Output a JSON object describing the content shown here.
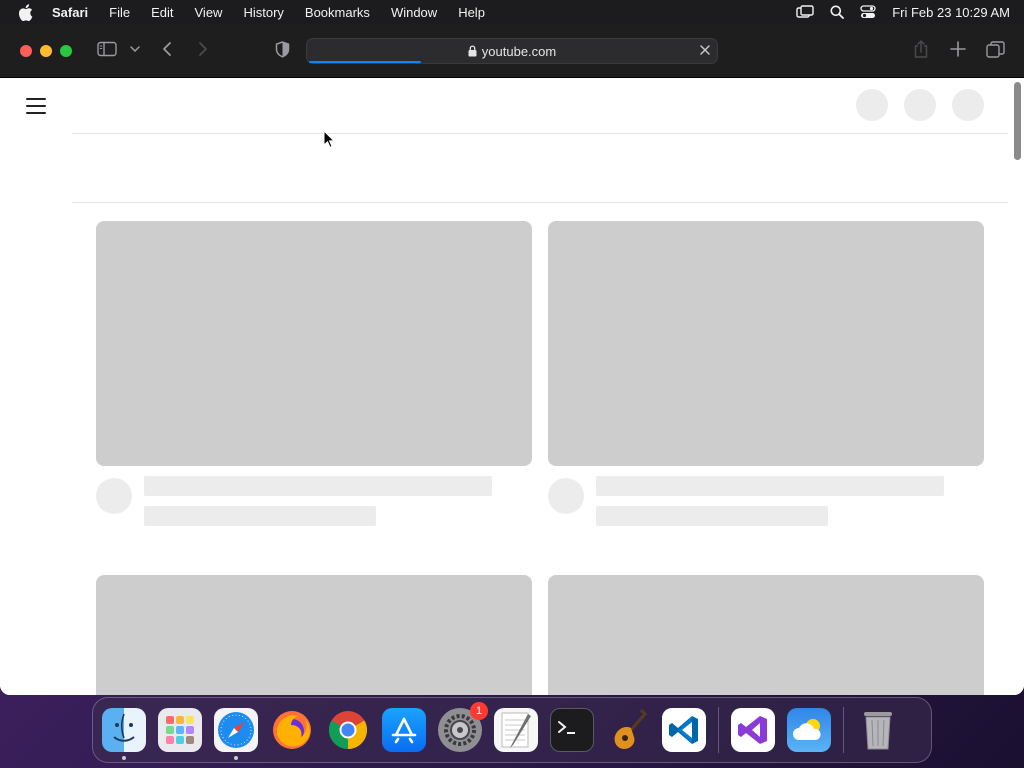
{
  "menubar": {
    "app_name": "Safari",
    "items": [
      "File",
      "Edit",
      "View",
      "History",
      "Bookmarks",
      "Window",
      "Help"
    ],
    "clock": "Fri Feb 23  10:29 AM",
    "status_icons": [
      "screen-mirroring-icon",
      "spotlight-search-icon",
      "control-center-icon"
    ]
  },
  "browser": {
    "url": "youtube.com",
    "loading": true,
    "colors": {
      "progress": "#0a84ff",
      "toolbar": "#1e1e1e"
    }
  },
  "page": {
    "state": "loading-skeleton"
  },
  "dock": {
    "apps": [
      {
        "name": "Finder",
        "icon": "finder-icon",
        "running": true
      },
      {
        "name": "Launchpad",
        "icon": "launchpad-icon",
        "running": false
      },
      {
        "name": "Safari",
        "icon": "safari-icon",
        "running": true
      },
      {
        "name": "Firefox",
        "icon": "firefox-icon",
        "running": false
      },
      {
        "name": "Google Chrome",
        "icon": "chrome-icon",
        "running": false
      },
      {
        "name": "App Store",
        "icon": "app-store-icon",
        "running": false
      },
      {
        "name": "System Settings",
        "icon": "system-settings-icon",
        "running": false,
        "badge": "1"
      },
      {
        "name": "TextEdit",
        "icon": "textedit-icon",
        "running": false
      },
      {
        "name": "Terminal",
        "icon": "terminal-icon",
        "running": false
      },
      {
        "name": "GarageBand",
        "icon": "garageband-icon",
        "running": false
      },
      {
        "name": "Visual Studio Code",
        "icon": "vscode-icon",
        "running": false
      },
      {
        "name": "Visual Studio",
        "icon": "visual-studio-icon",
        "running": false
      },
      {
        "name": "Weather",
        "icon": "weather-icon",
        "running": false
      },
      {
        "name": "Trash",
        "icon": "trash-icon",
        "running": false
      }
    ]
  }
}
